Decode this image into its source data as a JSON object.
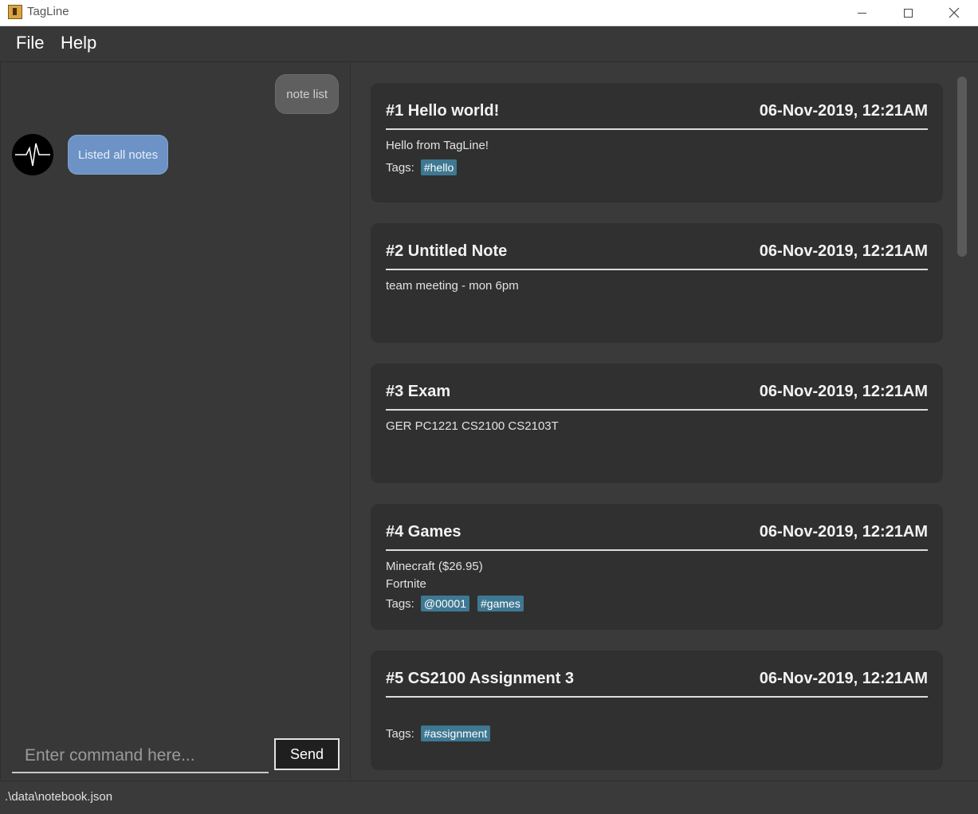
{
  "window": {
    "title": "TagLine"
  },
  "menu": {
    "file": "File",
    "help": "Help"
  },
  "chat": {
    "user_message": "note list",
    "bot_message": "Listed all notes",
    "input_placeholder": "Enter command here...",
    "send_label": "Send"
  },
  "notes": [
    {
      "title": "#1 Hello world!",
      "date": "06-Nov-2019, 12:21AM",
      "body": [
        "Hello from TagLine!"
      ],
      "tags_label": "Tags:",
      "tags": [
        "#hello"
      ]
    },
    {
      "title": "#2 Untitled Note",
      "date": "06-Nov-2019, 12:21AM",
      "body": [
        "team meeting - mon 6pm"
      ],
      "tags_label": "",
      "tags": []
    },
    {
      "title": "#3 Exam",
      "date": "06-Nov-2019, 12:21AM",
      "body": [
        "GER PC1221 CS2100 CS2103T"
      ],
      "tags_label": "",
      "tags": []
    },
    {
      "title": "#4 Games",
      "date": "06-Nov-2019, 12:21AM",
      "body": [
        "Minecraft ($26.95)",
        "Fortnite"
      ],
      "tags_label": "Tags:",
      "tags": [
        "@00001",
        "#games"
      ]
    },
    {
      "title": "#5 CS2100 Assignment 3",
      "date": "06-Nov-2019, 12:21AM",
      "body": [],
      "tags_label": "Tags:",
      "tags": [
        "#assignment"
      ]
    }
  ],
  "status": {
    "path": ".\\data\\notebook.json"
  },
  "colors": {
    "tag_bg": "#3e7892",
    "bot_bubble": "#6d93c6",
    "user_bubble": "#5f5f5f"
  }
}
